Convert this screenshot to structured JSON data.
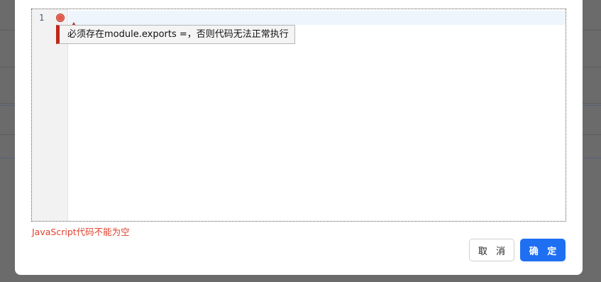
{
  "editor": {
    "line_numbers": [
      "1"
    ],
    "error_tooltip": "必须存在module.exports =，否则代码无法正常执行",
    "marker_icon": "error-dot-icon"
  },
  "validation": {
    "error_message": "JavaScript代码不能为空",
    "error_color": "#e0432f"
  },
  "footer": {
    "cancel_label": "取 消",
    "confirm_label": "确 定",
    "confirm_color": "#1f6ff2"
  }
}
